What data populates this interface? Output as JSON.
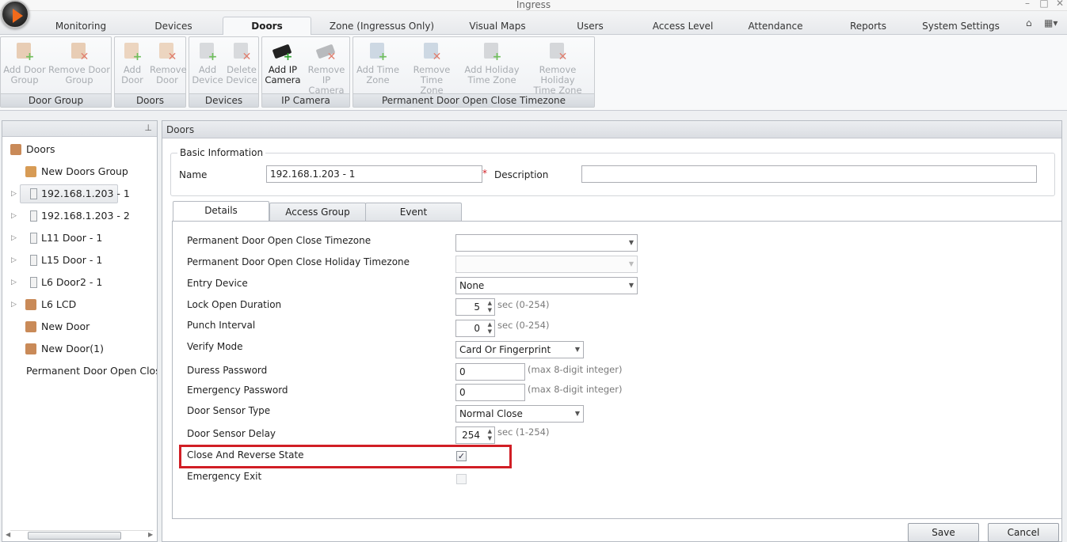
{
  "window": {
    "title": "Ingress",
    "controls": [
      "–",
      "□",
      "✕"
    ]
  },
  "menu_tabs": [
    "Monitoring",
    "Devices",
    "Doors",
    "Zone (Ingressus Only)",
    "Visual Maps",
    "Users",
    "Access Level",
    "Attendance",
    "Reports",
    "System Settings"
  ],
  "active_tab": "Doors",
  "ribbon": {
    "groups": [
      {
        "caption": "Door Group",
        "buttons": [
          {
            "label1": "Add Door",
            "label2": "Group",
            "icon": "door-group-add-icon"
          },
          {
            "label1": "Remove Door",
            "label2": "Group",
            "icon": "door-group-remove-icon"
          }
        ]
      },
      {
        "caption": "Doors",
        "buttons": [
          {
            "label1": "Add",
            "label2": "Door",
            "icon": "door-add-icon"
          },
          {
            "label1": "Remove",
            "label2": "Door",
            "icon": "door-remove-icon"
          }
        ]
      },
      {
        "caption": "Devices",
        "buttons": [
          {
            "label1": "Add",
            "label2": "Device",
            "icon": "device-add-icon"
          },
          {
            "label1": "Delete",
            "label2": "Device",
            "icon": "device-delete-icon"
          }
        ]
      },
      {
        "caption": "IP Camera",
        "buttons": [
          {
            "label1": "Add IP",
            "label2": "Camera",
            "icon": "camera-add-icon"
          },
          {
            "label1": "Remove IP",
            "label2": "Camera",
            "icon": "camera-remove-icon"
          }
        ]
      },
      {
        "caption": "Permanent Door Open Close Timezone",
        "buttons": [
          {
            "label1": "Add Time",
            "label2": "Zone",
            "icon": "timezone-add-icon"
          },
          {
            "label1": "Remove Time",
            "label2": "Zone",
            "icon": "timezone-remove-icon"
          },
          {
            "label1": "Add Holiday",
            "label2": "Time Zone",
            "icon": "holiday-timezone-add-icon"
          },
          {
            "label1": "Remove Holiday",
            "label2": "Time Zone",
            "icon": "holiday-timezone-remove-icon"
          }
        ]
      }
    ]
  },
  "tree": {
    "root": "Doors",
    "items": [
      "New Doors Group",
      "192.168.1.203 - 1",
      "192.168.1.203 - 2",
      "L11 Door - 1",
      "L15 Door - 1",
      "L6 Door2 - 1",
      "L6 LCD",
      "New Door",
      "New Door(1)"
    ],
    "second_root": "Permanent Door Open Close Ti",
    "selected": "192.168.1.203 - 1"
  },
  "panel": {
    "header": "Doors",
    "basic_info_legend": "Basic Information",
    "name_label": "Name",
    "name_value": "192.168.1.203 - 1",
    "required_mark": "*",
    "description_label": "Description",
    "description_value": ""
  },
  "detail_tabs": [
    "Details",
    "Access Group",
    "Event"
  ],
  "fields": {
    "perm_tz_label": "Permanent Door Open Close Timezone",
    "perm_tz_value": "",
    "perm_holiday_label": "Permanent Door Open Close Holiday Timezone",
    "perm_holiday_value": "",
    "entry_device_label": "Entry Device",
    "entry_device_value": "None",
    "lock_open_label": "Lock Open Duration",
    "lock_open_value": "5",
    "lock_open_hint": "sec (0-254)",
    "punch_label": "Punch Interval",
    "punch_value": "0",
    "punch_hint": "sec (0-254)",
    "verify_label": "Verify Mode",
    "verify_value": "Card Or Fingerprint",
    "duress_label": "Duress Password",
    "duress_value": "0",
    "duress_hint": "(max 8-digit integer)",
    "emergency_pw_label": "Emergency Password",
    "emergency_pw_value": "0",
    "emergency_pw_hint": "(max 8-digit integer)",
    "sensor_type_label": "Door Sensor Type",
    "sensor_type_value": "Normal Close",
    "sensor_delay_label": "Door Sensor Delay",
    "sensor_delay_value": "254",
    "sensor_delay_hint": "sec (1-254)",
    "close_reverse_label": "Close And Reverse State",
    "close_reverse_checked": "✓",
    "emergency_exit_label": "Emergency Exit",
    "emergency_exit_checked": ""
  },
  "buttons": {
    "save": "Save",
    "cancel": "Cancel"
  },
  "colors": {
    "highlight": "#d11e25",
    "orb_accent": "#f26a1b"
  }
}
